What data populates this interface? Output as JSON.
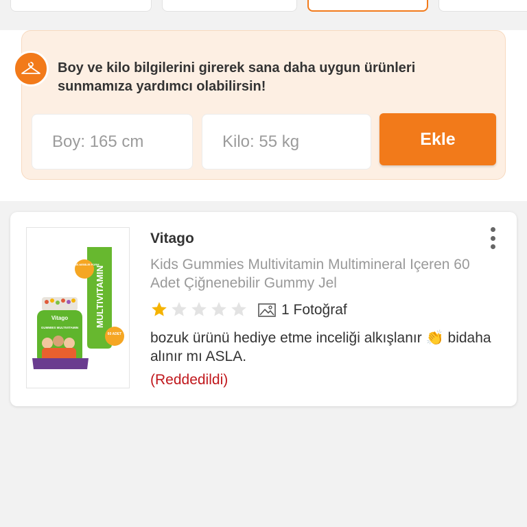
{
  "info": {
    "text": "Boy ve kilo bilgilerini girerek sana daha uygun ürünleri sunmamıza yardımcı olabilirsin!",
    "height_placeholder": "Boy: 165 cm",
    "weight_placeholder": "Kilo: 55 kg",
    "add_label": "Ekle",
    "icon": "hanger-icon"
  },
  "review": {
    "brand": "Vitago",
    "product": "Kids Gummies Multivitamin Multimineral Içeren 60 Adet Çiğnenebilir Gummy Jel",
    "rating": 1,
    "max_rating": 5,
    "photo_label": "1 Fotoğraf",
    "comment": "bozuk ürünü hediye etme inceliği alkışlanır 👏 bidaha alınır mı ASLA.",
    "status": "(Reddedildi)",
    "thumbnail": {
      "brand_text": "Vitago",
      "label": "MULTIVITAMIN",
      "jar_text": "GUMMIES MULTIVITAMIN",
      "badge_top": "ÇİĞNE-NEBİLİR FORM",
      "badge_bottom": "60 ADET"
    }
  },
  "colors": {
    "accent": "#f27a1a",
    "info_bg": "#fdefe3",
    "rejected": "#c0171c",
    "star_on": "#f5b301",
    "star_off": "#e3e3e3"
  }
}
